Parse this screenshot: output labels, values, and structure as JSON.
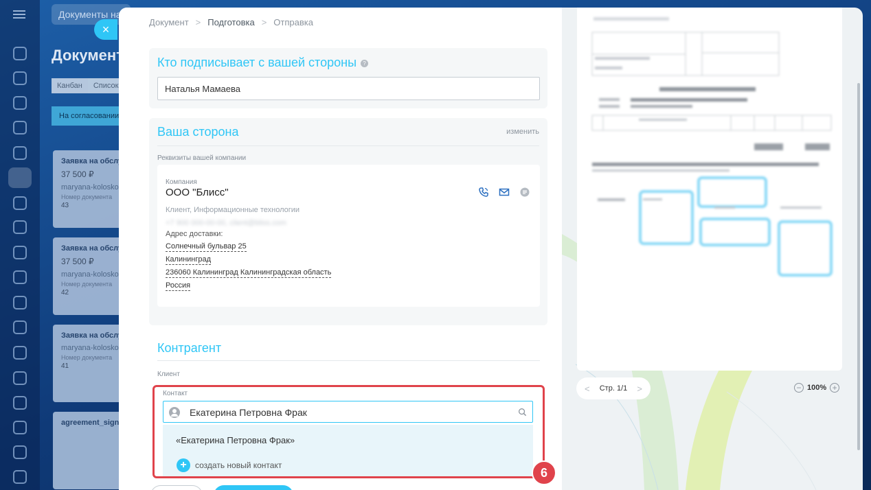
{
  "background": {
    "search_text": "Документы на",
    "page_title": "Документ",
    "tabs": [
      "Канбан",
      "Список"
    ],
    "stage_label": "На согласовании",
    "cards": [
      {
        "title": "Заявка на обслуживание",
        "price": "37 500 ₽",
        "user": "maryana-kolosko",
        "num_label": "Номер документа",
        "num": "43"
      },
      {
        "title": "Заявка на обслуживание",
        "price": "37 500 ₽",
        "user": "maryana-kolosko",
        "num_label": "Номер документа",
        "num": "42"
      },
      {
        "title": "Заявка на обслуживание",
        "price": "",
        "user": "maryana-kolosko",
        "num_label": "Номер документа",
        "num": "41"
      },
      {
        "title": "agreement_sign",
        "price": "",
        "user": "",
        "num_label": "",
        "num": ""
      }
    ]
  },
  "breadcrumbs": {
    "items": [
      "Документ",
      "Подготовка",
      "Отправка"
    ],
    "separator": ">"
  },
  "signer": {
    "title": "Кто подписывает с вашей стороны",
    "help": "?",
    "value": "Наталья Мамаева"
  },
  "your_side": {
    "title": "Ваша сторона",
    "change_label": "изменить",
    "requisites_label": "Реквизиты вашей компании",
    "company_label": "Компания",
    "company_name": "ООО \"Блисс\"",
    "company_meta": "Клиент, Информационные технологии",
    "company_contacts_blurred": "+7 900 000-00-00, client@bliss.com",
    "address_title": "Адрес доставки:",
    "address_lines": [
      "Солнечный бульвар 25",
      "Калининград",
      "236060 Калининград Калининградская область",
      "Россия"
    ]
  },
  "counterparty": {
    "title": "Контрагент",
    "client_label": "Клиент",
    "contact_label": "Контакт",
    "contact_value": "Екатерина Петровна Фрак",
    "dropdown": {
      "suggestion": "«Екатерина Петровна Фрак»",
      "create_label": "создать новый контакт"
    }
  },
  "step_badge": "6",
  "preview": {
    "page_label": "Стр. 1/1",
    "zoom_label": "100%",
    "prev": "<",
    "next": ">",
    "zoom_out": "−",
    "zoom_in": "+"
  },
  "close_button": "×",
  "colors": {
    "accent": "#2fc6f6",
    "highlight": "#e0434b",
    "panel_bg": "#eef2f4"
  }
}
